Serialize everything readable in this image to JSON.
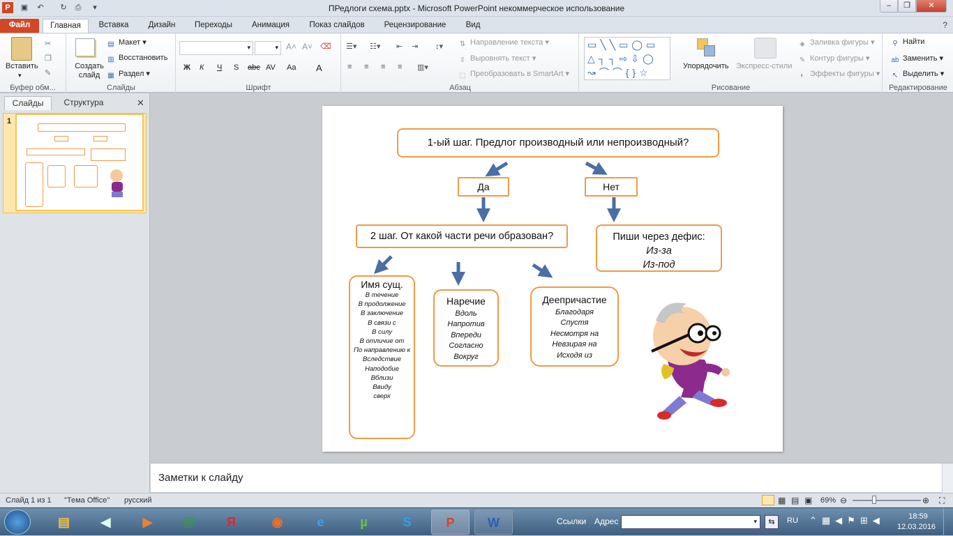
{
  "window": {
    "title": "ПРедлоги схема.pptx - Microsoft PowerPoint некоммерческое использование",
    "controls": [
      "–",
      "❐",
      "✕"
    ]
  },
  "ribbon_tabs": [
    "Файл",
    "Главная",
    "Вставка",
    "Дизайн",
    "Переходы",
    "Анимация",
    "Показ слайдов",
    "Рецензирование",
    "Вид"
  ],
  "ribbon": {
    "clipboard": {
      "paste": "Вставить",
      "label": "Буфер обм..."
    },
    "slides": {
      "create": "Создать слайд",
      "layout": "Макет",
      "reset": "Восстановить",
      "section": "Раздел",
      "label": "Слайды"
    },
    "font": {
      "label": "Шрифт",
      "bold": "Ж",
      "italic": "К",
      "underline": "Ч",
      "shadow": "S",
      "strike": "abc",
      "spacing": "AV",
      "case": "Aa",
      "color": "A"
    },
    "paragraph": {
      "label": "Абзац",
      "text_direction": "Направление текста",
      "align_text": "Выровнять текст",
      "smartart": "Преобразовать в SmartArt"
    },
    "drawing": {
      "label": "Рисование",
      "arrange": "Упорядочить",
      "quick_styles": "Экспресс-стили",
      "fill": "Заливка фигуры",
      "outline": "Контур фигуры",
      "effects": "Эффекты фигуры"
    },
    "editing": {
      "label": "Редактирование",
      "find": "Найти",
      "replace": "Заменить",
      "select": "Выделить"
    }
  },
  "left_pane": {
    "tab_slides": "Слайды",
    "tab_outline": "Структура",
    "slide_number": "1"
  },
  "slide": {
    "step1": "1-ый шаг. Предлог производный или непроизводный?",
    "yes": "Да",
    "no": "Нет",
    "step2": "2 шаг. От какой части речи образован?",
    "hyphen_title": "Пиши через дефис:",
    "hyphen_items": [
      "Из-за",
      "Из-под"
    ],
    "noun_title": "Имя сущ.",
    "noun_items": [
      "В течение",
      "В продолжение",
      "В заключение",
      "В связи с",
      "В силу",
      "В отличие от",
      "По направлению к",
      "Вследствие",
      "Наподобие",
      "Вблизи",
      "Ввиду",
      "сверх"
    ],
    "adverb_title": "Наречие",
    "adverb_items": [
      "Вдоль",
      "Напротив",
      "Впереди",
      "Согласно",
      "Вокруг"
    ],
    "gerund_title": "Деепричастие",
    "gerund_items": [
      "Благодаря",
      "Спустя",
      "Несмотря на",
      "Невзирая на",
      "Исходя из"
    ]
  },
  "notes": {
    "placeholder": "Заметки к слайду"
  },
  "status": {
    "slide": "Слайд 1 из 1",
    "theme": "\"Тема Office\"",
    "lang": "русский",
    "zoom": "69%"
  },
  "taskbar": {
    "links": "Ссылки",
    "address": "Адрес",
    "lang": "RU",
    "time": "18:59",
    "date": "12.03.2016"
  }
}
